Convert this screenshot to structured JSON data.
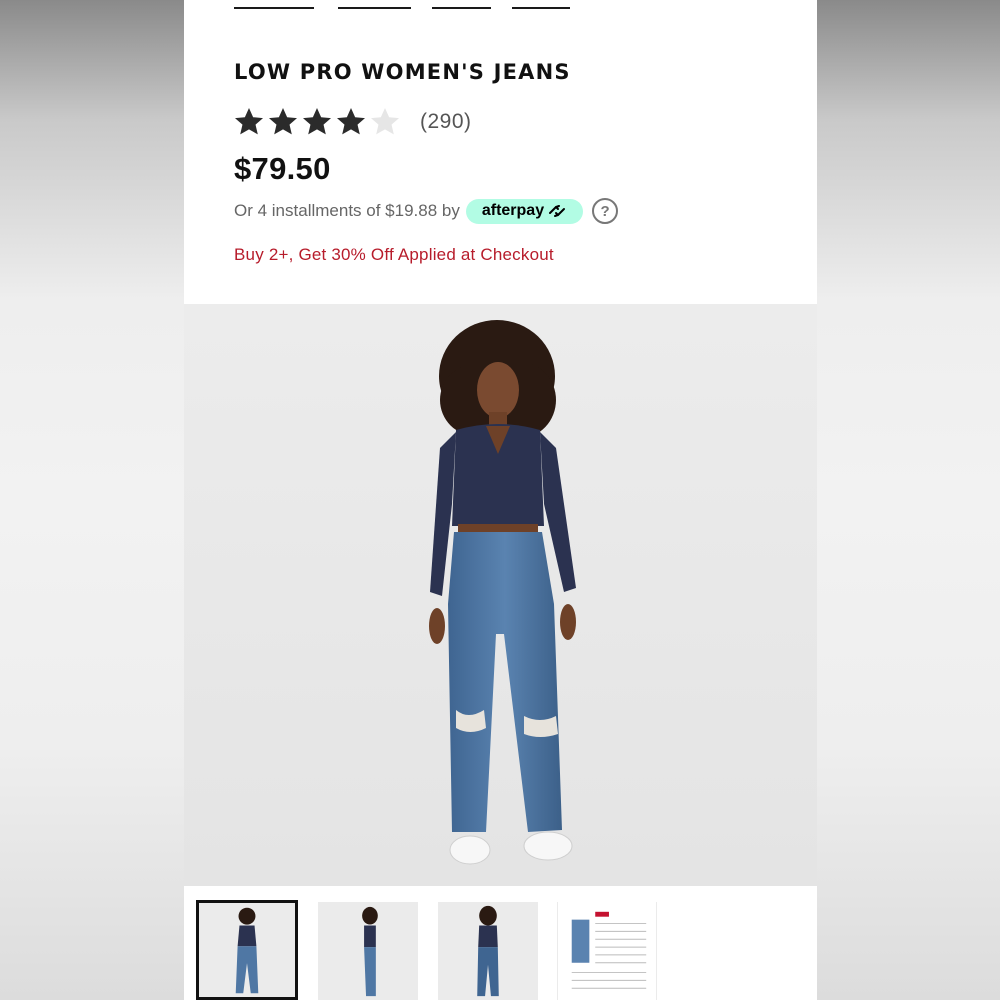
{
  "product": {
    "title": "LOW PRO WOMEN'S JEANS",
    "rating": 4,
    "rating_max": 5,
    "review_count": "(290)",
    "price": "$79.50",
    "installments_text": "Or 4 installments of $19.88 by",
    "afterpay_label": "afterpay",
    "help_icon": "?",
    "promo": "Buy 2+, Get 30% Off Applied at Checkout"
  },
  "icons": {
    "star": "star-icon",
    "help": "question-circle-icon",
    "afterpay_arrows": "afterpay-loop-icon"
  },
  "colors": {
    "promo": "#b71c2b",
    "afterpay_badge": "#b2fce4",
    "star_filled": "#2b2b2b",
    "star_empty": "#e6e6e6"
  },
  "gallery": {
    "selected_index": 0,
    "thumbnails": [
      {
        "name": "thumb-front-view"
      },
      {
        "name": "thumb-side-view"
      },
      {
        "name": "thumb-back-view"
      },
      {
        "name": "thumb-size-chart"
      }
    ]
  }
}
